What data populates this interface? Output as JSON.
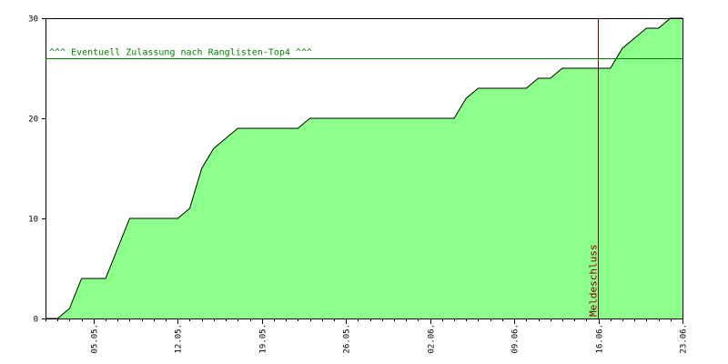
{
  "chart_data": {
    "type": "area",
    "title": "",
    "xlabel": "",
    "ylabel": "",
    "ylim": [
      0,
      30
    ],
    "yticks": [
      0,
      10,
      20,
      30
    ],
    "xlim": [
      0,
      53
    ],
    "x_tick_labels": [
      {
        "x": 4,
        "label": "05.05."
      },
      {
        "x": 11,
        "label": "12.05."
      },
      {
        "x": 18,
        "label": "19.05."
      },
      {
        "x": 25,
        "label": "26.05."
      },
      {
        "x": 32,
        "label": "02.06."
      },
      {
        "x": 39,
        "label": "09.06."
      },
      {
        "x": 46,
        "label": "16.06."
      },
      {
        "x": 53,
        "label": "23.06."
      }
    ],
    "series": [
      {
        "x": [
          0,
          1,
          2,
          3,
          4,
          5,
          6,
          7,
          8,
          9,
          10,
          11,
          12,
          13,
          14,
          15,
          16,
          17,
          18,
          19,
          20,
          21,
          22,
          23,
          24,
          25,
          26,
          27,
          28,
          29,
          30,
          31,
          32,
          33,
          34,
          35,
          36,
          37,
          38,
          39,
          40,
          41,
          42,
          43,
          44,
          45,
          46,
          47,
          48,
          49,
          50,
          51,
          52,
          53
        ],
        "values": [
          0,
          0,
          1,
          4,
          4,
          4,
          7,
          10,
          10,
          10,
          10,
          10,
          11,
          15,
          17,
          18,
          19,
          19,
          19,
          19,
          19,
          19,
          20,
          20,
          20,
          20,
          20,
          20,
          20,
          20,
          20,
          20,
          20,
          20,
          20,
          22,
          23,
          23,
          23,
          23,
          23,
          24,
          24,
          25,
          25,
          25,
          25,
          25,
          27,
          28,
          29,
          29,
          30,
          30
        ]
      }
    ],
    "hline": {
      "y": 26,
      "label": "^^^ Eventuell Zulassung nach Ranglisten-Top4 ^^^"
    },
    "vline": {
      "x": 46,
      "label": "Meldeschluss"
    },
    "colors": {
      "fill": "#8cff8c",
      "line": "#000000",
      "hline": "#008000",
      "vline": "#800000",
      "axis": "#000000"
    },
    "grid": false,
    "legend": "none"
  }
}
